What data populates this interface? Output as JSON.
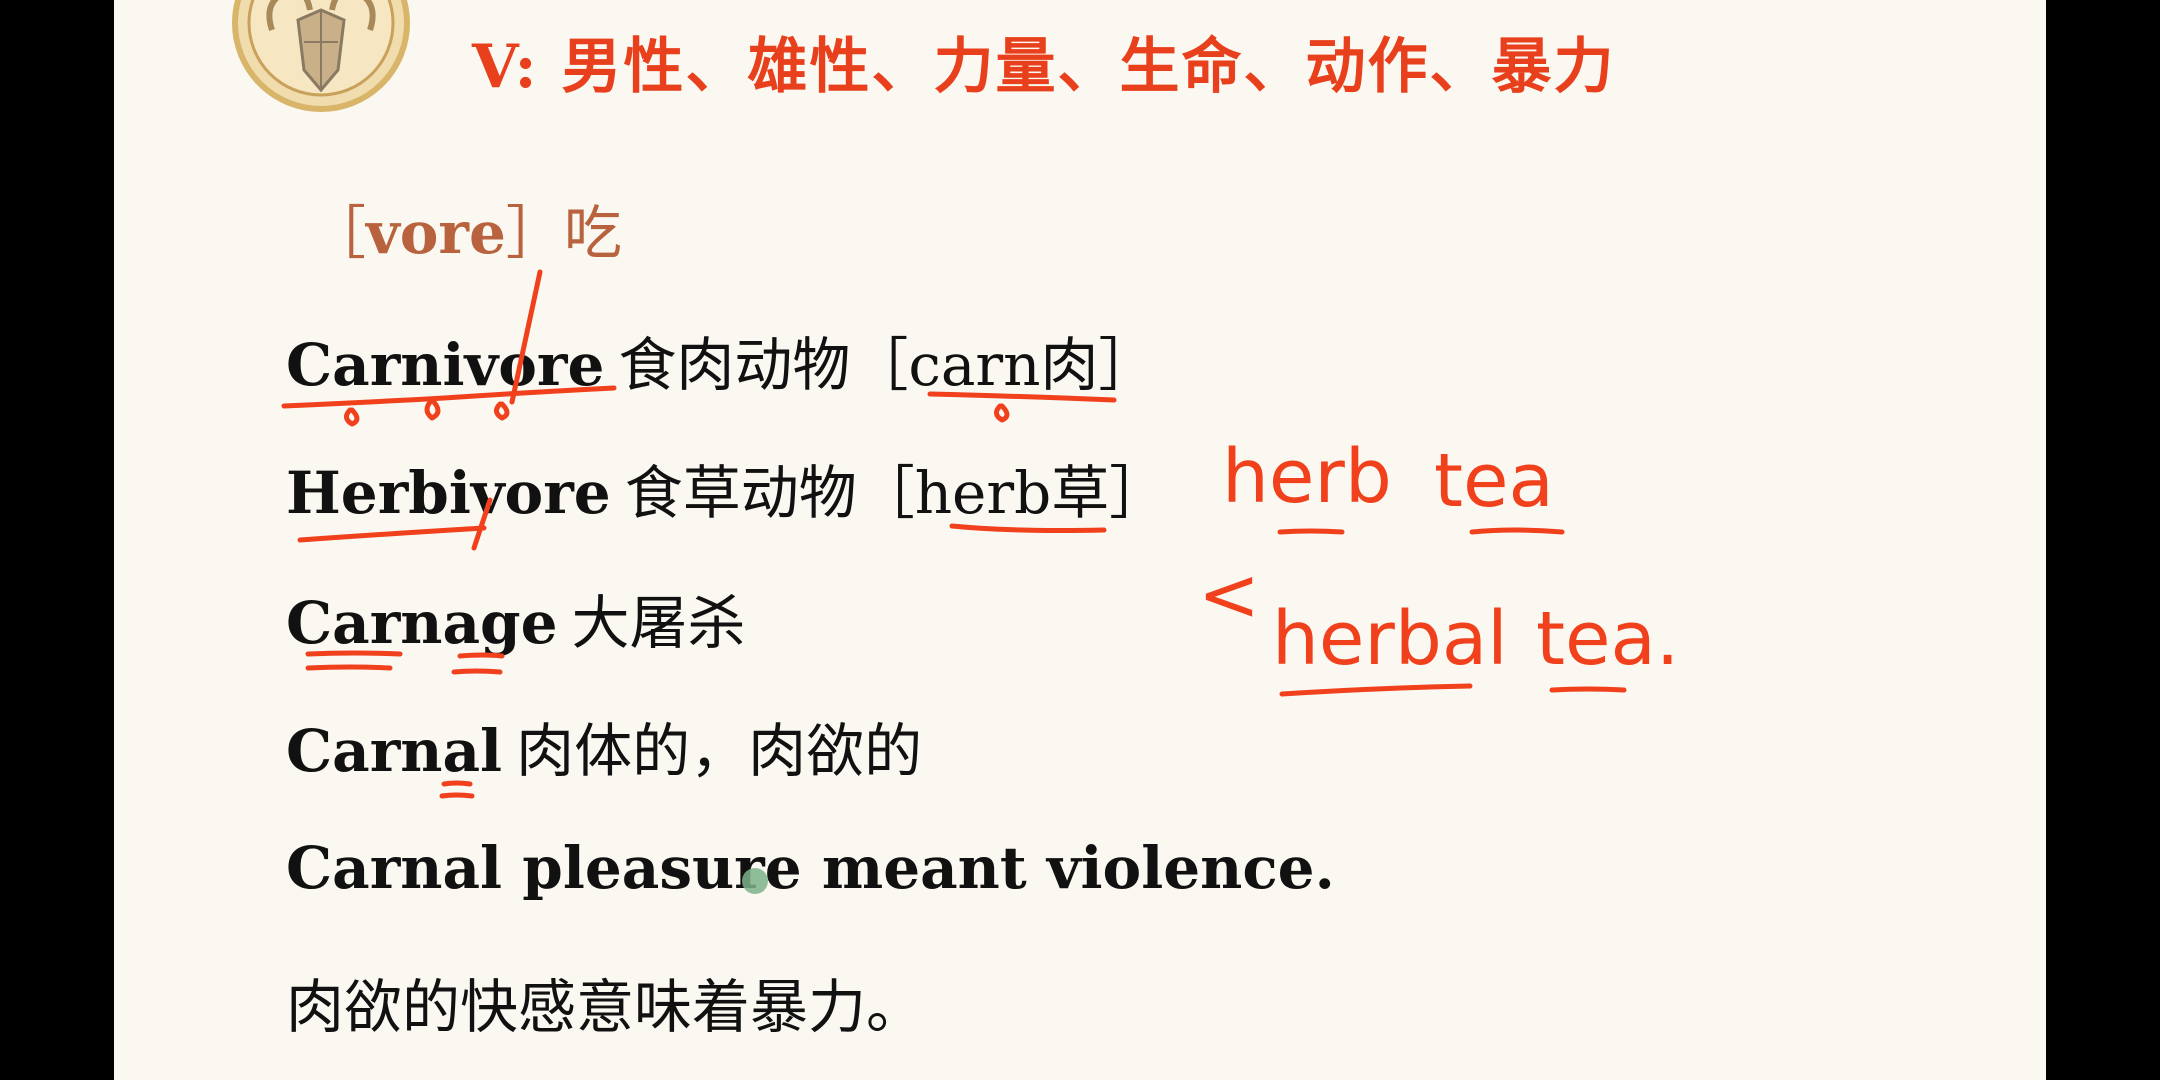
{
  "slide": {
    "title": "V: 男性、雄性、力量、生命、动作、暴力",
    "section": {
      "open_bracket": "［",
      "root": "vore",
      "close_bracket": "］",
      "meaning": "吃"
    },
    "entries": [
      {
        "word": "Carnivore",
        "meaning": "食肉动物［carn肉］"
      },
      {
        "word": "Herbivore",
        "meaning": "食草动物［herb草］"
      },
      {
        "word": "Carnage",
        "meaning": "大屠杀"
      },
      {
        "word": "Carnal",
        "meaning": "肉体的，肉欲的"
      }
    ],
    "example": {
      "sentence": "Carnal pleasure meant violence.",
      "translation": "肉欲的快感意味着暴力。"
    },
    "annotations": {
      "herb": "herb",
      "tea1": "tea",
      "lt": "<",
      "herbal": "herbal",
      "tea2": "tea."
    }
  },
  "colors": {
    "title": "#e8401c",
    "section": "#b8623e",
    "ink": "#f0401c",
    "background": "#faf8f1"
  },
  "icons": {
    "logo": "ram-head-icon"
  }
}
